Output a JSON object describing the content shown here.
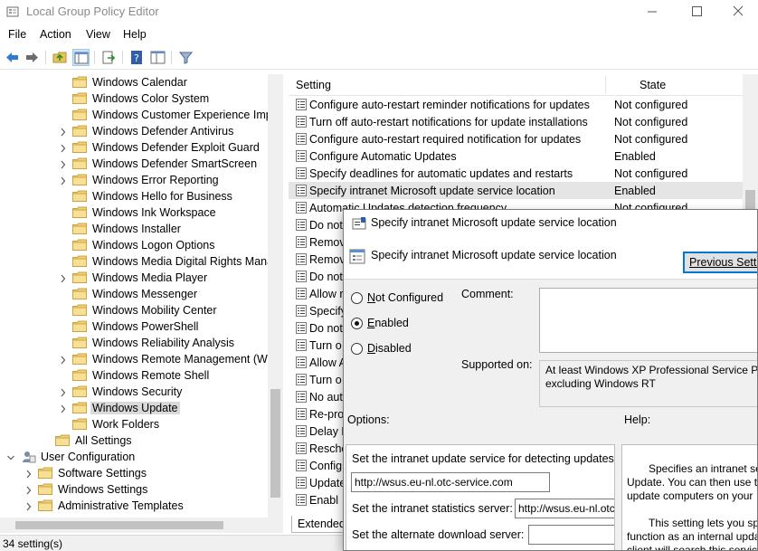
{
  "window": {
    "title": "Local Group Policy Editor"
  },
  "menu": [
    "File",
    "Action",
    "View",
    "Help"
  ],
  "toolbar_icons": [
    "back-arrow-icon",
    "forward-arrow-icon",
    "up-folder-icon",
    "show-hide-tree-icon",
    "export-list-icon",
    "help-icon",
    "extended-view-icon",
    "filter-icon"
  ],
  "tree": {
    "items": [
      {
        "label": "Windows Calendar",
        "chevron": false
      },
      {
        "label": "Windows Color System",
        "chevron": false
      },
      {
        "label": "Windows Customer Experience Impro",
        "chevron": false
      },
      {
        "label": "Windows Defender Antivirus",
        "chevron": true
      },
      {
        "label": "Windows Defender Exploit Guard",
        "chevron": true
      },
      {
        "label": "Windows Defender SmartScreen",
        "chevron": true
      },
      {
        "label": "Windows Error Reporting",
        "chevron": true
      },
      {
        "label": "Windows Hello for Business",
        "chevron": false
      },
      {
        "label": "Windows Ink Workspace",
        "chevron": false
      },
      {
        "label": "Windows Installer",
        "chevron": false
      },
      {
        "label": "Windows Logon Options",
        "chevron": false
      },
      {
        "label": "Windows Media Digital Rights Manag",
        "chevron": false
      },
      {
        "label": "Windows Media Player",
        "chevron": true
      },
      {
        "label": "Windows Messenger",
        "chevron": false
      },
      {
        "label": "Windows Mobility Center",
        "chevron": false
      },
      {
        "label": "Windows PowerShell",
        "chevron": false
      },
      {
        "label": "Windows Reliability Analysis",
        "chevron": false
      },
      {
        "label": "Windows Remote Management (Win",
        "chevron": true
      },
      {
        "label": "Windows Remote Shell",
        "chevron": false
      },
      {
        "label": "Windows Security",
        "chevron": true
      },
      {
        "label": "Windows Update",
        "chevron": true,
        "selected": true
      },
      {
        "label": "Work Folders",
        "chevron": false
      }
    ],
    "all_settings": "All Settings",
    "user_configuration": "User Configuration",
    "user_children": [
      "Software Settings",
      "Windows Settings",
      "Administrative Templates"
    ]
  },
  "list": {
    "col_setting": "Setting",
    "col_state": "State",
    "rows": [
      {
        "name": "Configure auto-restart reminder notifications for updates",
        "state": "Not configured"
      },
      {
        "name": "Turn off auto-restart notifications for update installations",
        "state": "Not configured"
      },
      {
        "name": "Configure auto-restart required notification for updates",
        "state": "Not configured"
      },
      {
        "name": "Configure Automatic Updates",
        "state": "Enabled"
      },
      {
        "name": "Specify deadlines for automatic updates and restarts",
        "state": "Not configured"
      },
      {
        "name": "Specify intranet Microsoft update service location",
        "state": "Enabled",
        "selected": true
      },
      {
        "name": "Automatic Updates detection frequency",
        "state": "Not configured"
      },
      {
        "name": "Do not",
        "state": ""
      },
      {
        "name": "Remov",
        "state": ""
      },
      {
        "name": "Remov",
        "state": ""
      },
      {
        "name": "Do not",
        "state": ""
      },
      {
        "name": "Allow n",
        "state": ""
      },
      {
        "name": "Specify",
        "state": ""
      },
      {
        "name": "Do not",
        "state": ""
      },
      {
        "name": "Turn o",
        "state": ""
      },
      {
        "name": "Allow A",
        "state": ""
      },
      {
        "name": "Turn o",
        "state": ""
      },
      {
        "name": "No aut",
        "state": ""
      },
      {
        "name": "Re-pro",
        "state": ""
      },
      {
        "name": "Delay R",
        "state": ""
      },
      {
        "name": "Resche",
        "state": ""
      },
      {
        "name": "Config",
        "state": ""
      },
      {
        "name": "Update",
        "state": ""
      },
      {
        "name": "Enabl",
        "state": ""
      }
    ],
    "tab_extended": "Extended"
  },
  "status": "34 setting(s)",
  "dialog": {
    "title": "Specify intranet Microsoft update service location",
    "heading": "Specify intranet Microsoft update service location",
    "previous_button": "Previous Setting",
    "radio_not_configured": "Not Configured",
    "radio_enabled": "Enabled",
    "radio_disabled": "Disabled",
    "selected_option": "Enabled",
    "comment_label": "Comment:",
    "supported_label": "Supported on:",
    "supported_line1": "At least Windows XP Professional Service Pack 1",
    "supported_line2": "excluding Windows RT",
    "options_label": "Options:",
    "help_label": "Help:",
    "options": {
      "detect_label": "Set the intranet update service for detecting updates:",
      "detect_value": "http://wsus.eu-nl.otc-service.com",
      "stats_label": "Set the intranet statistics server:",
      "stats_value": "http://wsus.eu-nl.otc-service.com",
      "alt_label": "Set the alternate download server:",
      "alt_value": ""
    },
    "help_lines": [
      "Specifies an intranet se",
      "Update. You can then use th",
      "update computers on your",
      "This setting lets you sp",
      "function as an internal upda",
      "client will search this service"
    ]
  }
}
